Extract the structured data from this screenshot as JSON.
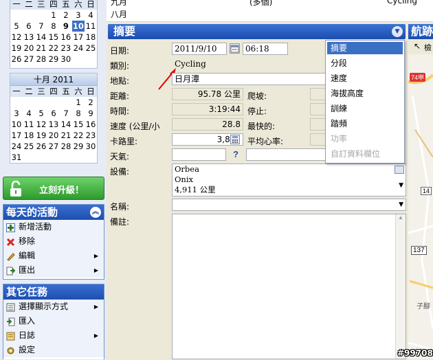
{
  "calendar_top": {
    "weekdays": [
      "一",
      "二",
      "三",
      "四",
      "五",
      "六",
      "日"
    ],
    "rows": [
      [
        "",
        "",
        "",
        "1",
        "2",
        "3",
        "4"
      ],
      [
        "5",
        "6",
        "7",
        "8",
        "9",
        "10",
        "11"
      ],
      [
        "12",
        "13",
        "14",
        "15",
        "16",
        "17",
        "18"
      ],
      [
        "19",
        "20",
        "21",
        "22",
        "23",
        "24",
        "25"
      ],
      [
        "26",
        "27",
        "28",
        "29",
        "30",
        "",
        ""
      ]
    ],
    "bold_day": "9",
    "today": "10"
  },
  "calendar_oct": {
    "title": "十月 2011",
    "weekdays": [
      "一",
      "二",
      "三",
      "四",
      "五",
      "六",
      "日"
    ],
    "rows": [
      [
        "",
        "",
        "",
        "",
        "",
        "1",
        "2"
      ],
      [
        "3",
        "4",
        "5",
        "6",
        "7",
        "8",
        "9"
      ],
      [
        "10",
        "11",
        "12",
        "13",
        "14",
        "15",
        "16"
      ],
      [
        "17",
        "18",
        "19",
        "20",
        "21",
        "22",
        "23"
      ],
      [
        "24",
        "25",
        "26",
        "27",
        "28",
        "29",
        "30"
      ],
      [
        "31",
        "",
        "",
        "",
        "",
        "",
        ""
      ]
    ]
  },
  "upgrade_button": "立刻升級！",
  "daily_panel": {
    "title": "每天的活動",
    "items": [
      {
        "label": "新增活動",
        "submenu": false
      },
      {
        "label": "移除",
        "submenu": false
      },
      {
        "label": "編輯",
        "submenu": true
      },
      {
        "label": "匯出",
        "submenu": true
      }
    ]
  },
  "other_panel": {
    "title": "其它任務",
    "items": [
      {
        "label": "選擇顯示方式",
        "submenu": true
      },
      {
        "label": "匯入",
        "submenu": false
      },
      {
        "label": "日誌",
        "submenu": true
      },
      {
        "label": "設定",
        "submenu": false
      }
    ]
  },
  "list_rows": [
    {
      "month": "九月",
      "mid": "(多個)",
      "right": "Cycling"
    },
    {
      "month": "八月",
      "mid": "",
      "right": ""
    }
  ],
  "summary": {
    "title": "摘要",
    "nav_title": "航跡",
    "date_label": "日期:",
    "date_value": "2011/9/10",
    "time_value": "06:18",
    "category_label": "類別:",
    "category_value": "Cycling",
    "location_label": "地點:",
    "location_value": "日月潭",
    "distance_label": "距離:",
    "distance_value": "95.78 公里",
    "climb_label": "爬坡:",
    "time_label": "時間:",
    "time_duration": "3:19:44",
    "stop_label": "停止:",
    "speed_label": "速度 (公里/小",
    "speed_value": "28.8",
    "fastest_label": "最快的:",
    "calories_label": "卡路里:",
    "calories_value": "3,805",
    "avg_hr_label": "平均心率:",
    "weather_label": "天氣:",
    "equipment_label": "設備:",
    "equipment_lines": [
      "Orbea",
      "Onix",
      "4,911 公里"
    ],
    "name_label": "名稱:",
    "notes_label": "備註:"
  },
  "dropdown_menu": {
    "items": [
      {
        "label": "摘要",
        "selected": true,
        "disabled": false
      },
      {
        "label": "分段",
        "selected": false,
        "disabled": false
      },
      {
        "label": "速度",
        "selected": false,
        "disabled": false
      },
      {
        "label": "海拔高度",
        "selected": false,
        "disabled": false
      },
      {
        "label": "訓練",
        "selected": false,
        "disabled": false
      },
      {
        "label": "踏頻",
        "selected": false,
        "disabled": false
      },
      {
        "label": "功率",
        "selected": false,
        "disabled": true
      },
      {
        "label": "自訂資料欄位",
        "selected": false,
        "disabled": true
      }
    ]
  },
  "map": {
    "search_label": "檢",
    "road_74": "74甲",
    "road_137": "137",
    "road_14": "14",
    "place_1": "子腳"
  },
  "watermark": "#99708",
  "colors": {
    "header_blue": "#1b4cad",
    "today_blue": "#3b6fc4",
    "upgrade_green": "#2e9a2c",
    "annotation_red": "#e00000"
  }
}
